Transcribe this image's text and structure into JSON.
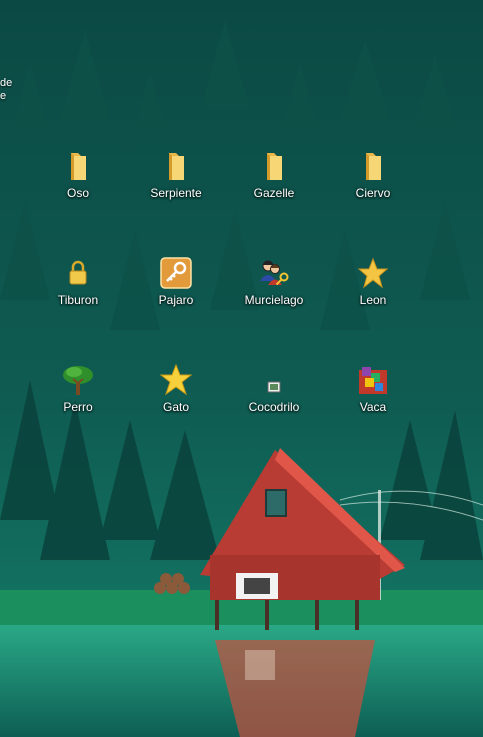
{
  "desktop": {
    "clipped_label_line1": "de",
    "clipped_label_line2": "e",
    "icons": [
      {
        "label": "Oso",
        "icon": "folder-icon"
      },
      {
        "label": "Serpiente",
        "icon": "folder-icon"
      },
      {
        "label": "Gazelle",
        "icon": "folder-icon"
      },
      {
        "label": "Ciervo",
        "icon": "folder-icon"
      },
      {
        "label": "Tiburon",
        "icon": "padlock-icon"
      },
      {
        "label": "Pajaro",
        "icon": "key-icon"
      },
      {
        "label": "Murcielago",
        "icon": "users-key-icon"
      },
      {
        "label": "Leon",
        "icon": "star-icon"
      },
      {
        "label": "Perro",
        "icon": "tree-icon"
      },
      {
        "label": "Gato",
        "icon": "star-icon"
      },
      {
        "label": "Cocodrilo",
        "icon": "small-image-icon"
      },
      {
        "label": "Vaca",
        "icon": "cubes-box-icon"
      }
    ]
  },
  "colors": {
    "wallpaper_dark": "#0b3d38",
    "wallpaper_mid": "#14655b",
    "cabin_red": "#c8463c",
    "water": "#1f8a73"
  }
}
